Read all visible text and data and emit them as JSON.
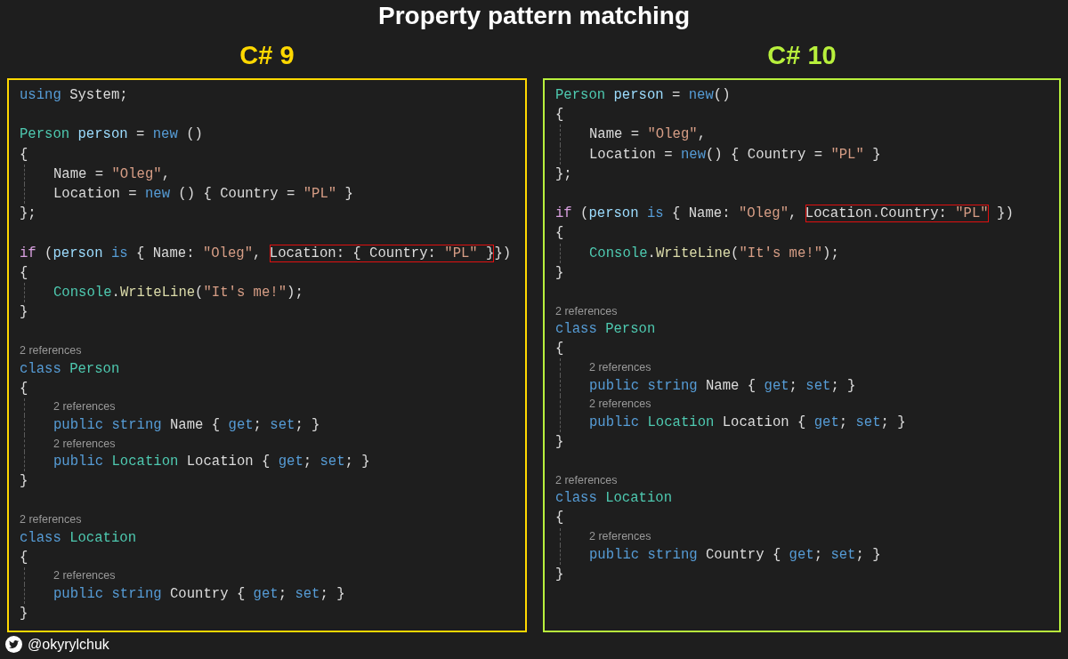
{
  "title": "Property pattern matching",
  "panels": [
    {
      "title": "C# 9",
      "color": "#ffd800",
      "lines": [
        {
          "kind": "code",
          "indented": false,
          "tokens": [
            {
              "kind": "kw",
              "text": "using"
            },
            {
              "kind": "plain",
              "text": " System;"
            }
          ]
        },
        {
          "kind": "blank"
        },
        {
          "kind": "code",
          "indented": false,
          "tokens": [
            {
              "kind": "type",
              "text": "Person "
            },
            {
              "kind": "var",
              "text": "person"
            },
            {
              "kind": "plain",
              "text": " = "
            },
            {
              "kind": "kw",
              "text": "new"
            },
            {
              "kind": "plain",
              "text": " ()"
            }
          ]
        },
        {
          "kind": "code",
          "indented": false,
          "tokens": [
            {
              "kind": "plain",
              "text": "{"
            }
          ]
        },
        {
          "kind": "code",
          "indented": true,
          "tokens": [
            {
              "kind": "plain",
              "text": "Name = "
            },
            {
              "kind": "str",
              "text": "\"Oleg\""
            },
            {
              "kind": "plain",
              "text": ","
            }
          ]
        },
        {
          "kind": "code",
          "indented": true,
          "tokens": [
            {
              "kind": "plain",
              "text": "Location = "
            },
            {
              "kind": "kw",
              "text": "new"
            },
            {
              "kind": "plain",
              "text": " () { Country = "
            },
            {
              "kind": "str",
              "text": "\"PL\""
            },
            {
              "kind": "plain",
              "text": " }"
            }
          ]
        },
        {
          "kind": "code",
          "indented": false,
          "tokens": [
            {
              "kind": "plain",
              "text": "};"
            }
          ]
        },
        {
          "kind": "blank"
        },
        {
          "kind": "code",
          "indented": false,
          "tokens": [
            {
              "kind": "ctrl",
              "text": "if"
            },
            {
              "kind": "plain",
              "text": " ("
            },
            {
              "kind": "var",
              "text": "person "
            },
            {
              "kind": "kw",
              "text": "is"
            },
            {
              "kind": "plain",
              "text": " { Name: "
            },
            {
              "kind": "str",
              "text": "\"Oleg\""
            },
            {
              "kind": "plain",
              "text": ", "
            },
            {
              "kind": "box",
              "tokens": [
                {
                  "kind": "plain",
                  "text": "Location: { Country: "
                },
                {
                  "kind": "str",
                  "text": "\"PL\""
                },
                {
                  "kind": "plain",
                  "text": " }"
                }
              ]
            },
            {
              "kind": "plain",
              "text": "})"
            }
          ]
        },
        {
          "kind": "code",
          "indented": false,
          "tokens": [
            {
              "kind": "plain",
              "text": "{"
            }
          ]
        },
        {
          "kind": "code",
          "indented": true,
          "tokens": [
            {
              "kind": "type",
              "text": "Console"
            },
            {
              "kind": "plain",
              "text": "."
            },
            {
              "kind": "method",
              "text": "WriteLine"
            },
            {
              "kind": "plain",
              "text": "("
            },
            {
              "kind": "str",
              "text": "\"It's me!\""
            },
            {
              "kind": "plain",
              "text": ");"
            }
          ]
        },
        {
          "kind": "code",
          "indented": false,
          "tokens": [
            {
              "kind": "plain",
              "text": "}"
            }
          ]
        },
        {
          "kind": "blank"
        },
        {
          "kind": "refs",
          "indented": false,
          "text": "2 references"
        },
        {
          "kind": "code",
          "indented": false,
          "tokens": [
            {
              "kind": "kw",
              "text": "class "
            },
            {
              "kind": "type",
              "text": "Person"
            }
          ]
        },
        {
          "kind": "code",
          "indented": false,
          "tokens": [
            {
              "kind": "plain",
              "text": "{"
            }
          ]
        },
        {
          "kind": "refs",
          "indented": true,
          "text": "2 references"
        },
        {
          "kind": "code",
          "indented": true,
          "tokens": [
            {
              "kind": "kw",
              "text": "public string"
            },
            {
              "kind": "plain",
              "text": " Name { "
            },
            {
              "kind": "kw",
              "text": "get"
            },
            {
              "kind": "plain",
              "text": "; "
            },
            {
              "kind": "kw",
              "text": "set"
            },
            {
              "kind": "plain",
              "text": "; }"
            }
          ]
        },
        {
          "kind": "refs",
          "indented": true,
          "text": "2 references"
        },
        {
          "kind": "code",
          "indented": true,
          "tokens": [
            {
              "kind": "kw",
              "text": "public "
            },
            {
              "kind": "type",
              "text": "Location"
            },
            {
              "kind": "plain",
              "text": " Location { "
            },
            {
              "kind": "kw",
              "text": "get"
            },
            {
              "kind": "plain",
              "text": "; "
            },
            {
              "kind": "kw",
              "text": "set"
            },
            {
              "kind": "plain",
              "text": "; }"
            }
          ]
        },
        {
          "kind": "code",
          "indented": false,
          "tokens": [
            {
              "kind": "plain",
              "text": "}"
            }
          ]
        },
        {
          "kind": "blank"
        },
        {
          "kind": "refs",
          "indented": false,
          "text": "2 references"
        },
        {
          "kind": "code",
          "indented": false,
          "tokens": [
            {
              "kind": "kw",
              "text": "class "
            },
            {
              "kind": "type",
              "text": "Location"
            }
          ]
        },
        {
          "kind": "code",
          "indented": false,
          "tokens": [
            {
              "kind": "plain",
              "text": "{"
            }
          ]
        },
        {
          "kind": "refs",
          "indented": true,
          "text": "2 references"
        },
        {
          "kind": "code",
          "indented": true,
          "tokens": [
            {
              "kind": "kw",
              "text": "public string"
            },
            {
              "kind": "plain",
              "text": " Country { "
            },
            {
              "kind": "kw",
              "text": "get"
            },
            {
              "kind": "plain",
              "text": "; "
            },
            {
              "kind": "kw",
              "text": "set"
            },
            {
              "kind": "plain",
              "text": "; }"
            }
          ]
        },
        {
          "kind": "code",
          "indented": false,
          "tokens": [
            {
              "kind": "plain",
              "text": "}"
            }
          ]
        }
      ]
    },
    {
      "title": "C# 10",
      "color": "#b8f03c",
      "lines": [
        {
          "kind": "code",
          "indented": false,
          "tokens": [
            {
              "kind": "type",
              "text": "Person "
            },
            {
              "kind": "var",
              "text": "person"
            },
            {
              "kind": "plain",
              "text": " = "
            },
            {
              "kind": "kw",
              "text": "new"
            },
            {
              "kind": "plain",
              "text": "()"
            }
          ]
        },
        {
          "kind": "code",
          "indented": false,
          "tokens": [
            {
              "kind": "plain",
              "text": "{"
            }
          ]
        },
        {
          "kind": "code",
          "indented": true,
          "tokens": [
            {
              "kind": "plain",
              "text": "Name = "
            },
            {
              "kind": "str",
              "text": "\"Oleg\""
            },
            {
              "kind": "plain",
              "text": ","
            }
          ]
        },
        {
          "kind": "code",
          "indented": true,
          "tokens": [
            {
              "kind": "plain",
              "text": "Location = "
            },
            {
              "kind": "kw",
              "text": "new"
            },
            {
              "kind": "plain",
              "text": "() { Country = "
            },
            {
              "kind": "str",
              "text": "\"PL\""
            },
            {
              "kind": "plain",
              "text": " }"
            }
          ]
        },
        {
          "kind": "code",
          "indented": false,
          "tokens": [
            {
              "kind": "plain",
              "text": "};"
            }
          ]
        },
        {
          "kind": "blank"
        },
        {
          "kind": "code",
          "indented": false,
          "tokens": [
            {
              "kind": "ctrl",
              "text": "if"
            },
            {
              "kind": "plain",
              "text": " ("
            },
            {
              "kind": "var",
              "text": "person "
            },
            {
              "kind": "kw",
              "text": "is"
            },
            {
              "kind": "plain",
              "text": " { Name: "
            },
            {
              "kind": "str",
              "text": "\"Oleg\""
            },
            {
              "kind": "plain",
              "text": ", "
            },
            {
              "kind": "box",
              "tokens": [
                {
                  "kind": "plain",
                  "text": "Location.Country: "
                },
                {
                  "kind": "str",
                  "text": "\"PL\""
                }
              ]
            },
            {
              "kind": "plain",
              "text": " })"
            }
          ]
        },
        {
          "kind": "code",
          "indented": false,
          "tokens": [
            {
              "kind": "plain",
              "text": "{"
            }
          ]
        },
        {
          "kind": "code",
          "indented": true,
          "tokens": [
            {
              "kind": "type",
              "text": "Console"
            },
            {
              "kind": "plain",
              "text": "."
            },
            {
              "kind": "method",
              "text": "WriteLine"
            },
            {
              "kind": "plain",
              "text": "("
            },
            {
              "kind": "str",
              "text": "\"It's me!\""
            },
            {
              "kind": "plain",
              "text": ");"
            }
          ]
        },
        {
          "kind": "code",
          "indented": false,
          "tokens": [
            {
              "kind": "plain",
              "text": "}"
            }
          ]
        },
        {
          "kind": "blank"
        },
        {
          "kind": "refs",
          "indented": false,
          "text": "2 references"
        },
        {
          "kind": "code",
          "indented": false,
          "tokens": [
            {
              "kind": "kw",
              "text": "class "
            },
            {
              "kind": "type",
              "text": "Person"
            }
          ]
        },
        {
          "kind": "code",
          "indented": false,
          "tokens": [
            {
              "kind": "plain",
              "text": "{"
            }
          ]
        },
        {
          "kind": "refs",
          "indented": true,
          "text": "2 references"
        },
        {
          "kind": "code",
          "indented": true,
          "tokens": [
            {
              "kind": "kw",
              "text": "public string"
            },
            {
              "kind": "plain",
              "text": " Name { "
            },
            {
              "kind": "kw",
              "text": "get"
            },
            {
              "kind": "plain",
              "text": "; "
            },
            {
              "kind": "kw",
              "text": "set"
            },
            {
              "kind": "plain",
              "text": "; }"
            }
          ]
        },
        {
          "kind": "refs",
          "indented": true,
          "text": "2 references"
        },
        {
          "kind": "code",
          "indented": true,
          "tokens": [
            {
              "kind": "kw",
              "text": "public "
            },
            {
              "kind": "type",
              "text": "Location"
            },
            {
              "kind": "plain",
              "text": " Location { "
            },
            {
              "kind": "kw",
              "text": "get"
            },
            {
              "kind": "plain",
              "text": "; "
            },
            {
              "kind": "kw",
              "text": "set"
            },
            {
              "kind": "plain",
              "text": "; }"
            }
          ]
        },
        {
          "kind": "code",
          "indented": false,
          "tokens": [
            {
              "kind": "plain",
              "text": "}"
            }
          ]
        },
        {
          "kind": "blank"
        },
        {
          "kind": "refs",
          "indented": false,
          "text": "2 references"
        },
        {
          "kind": "code",
          "indented": false,
          "tokens": [
            {
              "kind": "kw",
              "text": "class "
            },
            {
              "kind": "type",
              "text": "Location"
            }
          ]
        },
        {
          "kind": "code",
          "indented": false,
          "tokens": [
            {
              "kind": "plain",
              "text": "{"
            }
          ]
        },
        {
          "kind": "refs",
          "indented": true,
          "text": "2 references"
        },
        {
          "kind": "code",
          "indented": true,
          "tokens": [
            {
              "kind": "kw",
              "text": "public string"
            },
            {
              "kind": "plain",
              "text": " Country { "
            },
            {
              "kind": "kw",
              "text": "get"
            },
            {
              "kind": "plain",
              "text": "; "
            },
            {
              "kind": "kw",
              "text": "set"
            },
            {
              "kind": "plain",
              "text": "; }"
            }
          ]
        },
        {
          "kind": "code",
          "indented": false,
          "tokens": [
            {
              "kind": "plain",
              "text": "}"
            }
          ]
        }
      ]
    }
  ],
  "footer": {
    "handle": "@okyrylchuk"
  }
}
